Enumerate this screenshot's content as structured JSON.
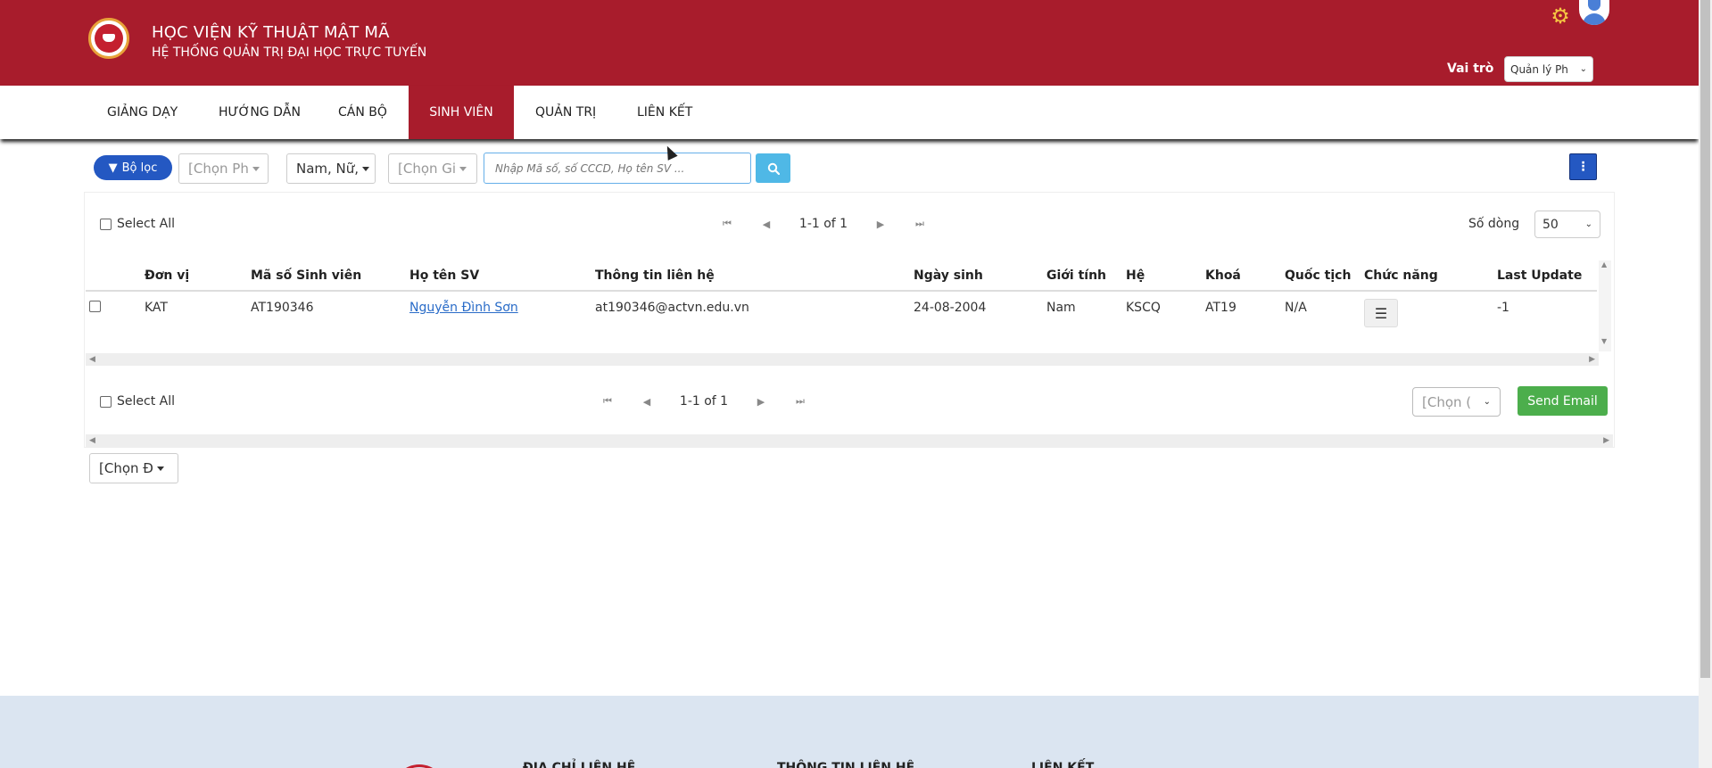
{
  "header": {
    "title": "HỌC VIỆN KỸ THUẬT MẬT MÃ",
    "subtitle": "HỆ THỐNG QUẢN TRỊ ĐẠI HỌC TRỰC TUYẾN",
    "role_label": "Vai trò",
    "role_value": "Quản lý Ph"
  },
  "nav": {
    "items": [
      {
        "label": "GIẢNG DẠY"
      },
      {
        "label": "HƯỚNG DẪN"
      },
      {
        "label": "CÁN BỘ"
      },
      {
        "label": "SINH VIÊN",
        "active": true
      },
      {
        "label": "QUẢN TRỊ"
      },
      {
        "label": "LIÊN KẾT"
      }
    ]
  },
  "toolbar": {
    "filter_label": "Bộ lọc",
    "dropdown_1": "[Chọn Ph",
    "dropdown_gender": "Nam, Nữ,",
    "dropdown_3": "[Chọn Gi",
    "search_placeholder": "Nhập Mã số, số CCCD, Họ tên SV ...",
    "more_icon": "vertical-dots-icon"
  },
  "list": {
    "select_all": "Select All",
    "pagination": "1-1 of 1",
    "rows_label": "Số dòng",
    "rows_value": "50",
    "columns": [
      "Đơn vị",
      "Mã số Sinh viên",
      "Họ tên SV",
      "Thông tin liên hệ",
      "Ngày sinh",
      "Giới tính",
      "Hệ",
      "Khoá",
      "Quốc tịch",
      "Chức năng",
      "Last Update"
    ],
    "rows": [
      {
        "unit": "KAT",
        "student_id": "AT190346",
        "name": "Nguyễn Đình Sơn",
        "contact": "at190346@actvn.edu.vn",
        "dob": "24-08-2004",
        "gender": "Nam",
        "system": "KSCQ",
        "cohort": "AT19",
        "nationality": "N/A",
        "last_update": "-1"
      }
    ],
    "bulk_select": "[Chọn (",
    "send_email": "Send Email"
  },
  "bottom": {
    "unit_dropdown": "[Chọn Đ"
  },
  "footer": {
    "col1": "ĐỊA CHỈ LIÊN HỆ",
    "col2": "THÔNG TIN LIÊN HỆ",
    "col3": "LIÊN KẾT"
  },
  "colors": {
    "brand": "#a81c2c",
    "primary": "#2458c2",
    "success": "#4cae4c",
    "info": "#4fb8e6",
    "footer_bg": "#dbe5f1"
  }
}
